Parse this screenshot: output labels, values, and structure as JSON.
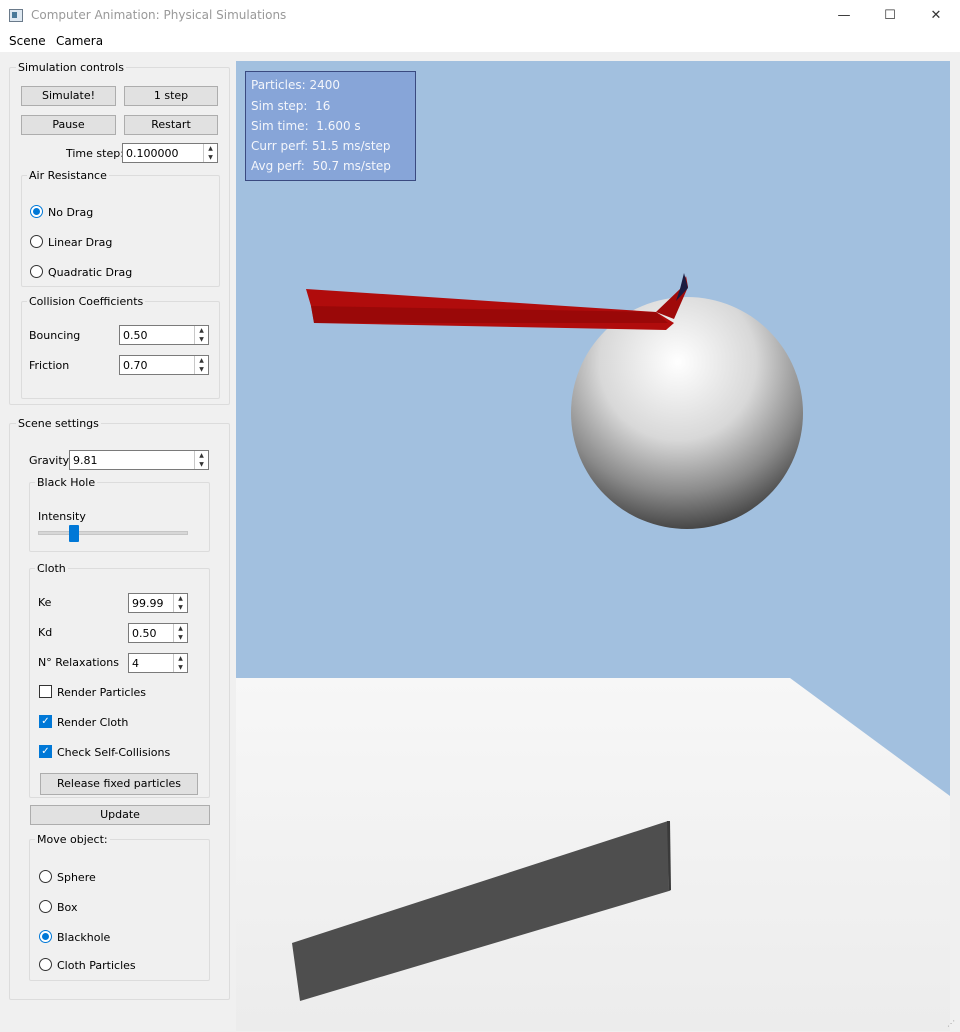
{
  "window": {
    "title": "Computer Animation: Physical Simulations",
    "minimize": "—",
    "maximize": "☐",
    "close": "✕"
  },
  "menu": {
    "scene": "Scene",
    "camera": "Camera"
  },
  "simulation_controls": {
    "title": "Simulation controls",
    "simulate_label": "Simulate!",
    "step_label": "1 step",
    "pause_label": "Pause",
    "restart_label": "Restart",
    "time_step_label": "Time step:",
    "time_step_value": "0.100000",
    "air_resistance": {
      "title": "Air Resistance",
      "options": [
        "No Drag",
        "Linear Drag",
        "Quadratic Drag"
      ],
      "selected": "No Drag"
    },
    "collision": {
      "title": "Collision Coefficients",
      "bouncing_label": "Bouncing",
      "bouncing_value": "0.50",
      "friction_label": "Friction",
      "friction_value": "0.70"
    }
  },
  "scene_settings": {
    "title": "Scene settings",
    "gravity_label": "Gravity",
    "gravity_value": "9.81",
    "black_hole": {
      "title": "Black Hole",
      "intensity_label": "Intensity",
      "intensity_level": 0.22
    },
    "cloth": {
      "title": "Cloth",
      "ke_label": "Ke",
      "ke_value": "99.99",
      "kd_label": "Kd",
      "kd_value": "0.50",
      "relax_label": "N° Relaxations",
      "relax_value": "4",
      "render_particles_label": "Render Particles",
      "render_particles": false,
      "render_cloth_label": "Render Cloth",
      "render_cloth": true,
      "self_collisions_label": "Check Self-Collisions",
      "self_collisions": true,
      "release_label": "Release fixed particles"
    },
    "update_label": "Update",
    "move_object": {
      "title": "Move object:",
      "options": [
        "Sphere",
        "Box",
        "Blackhole",
        "Cloth Particles"
      ],
      "selected": "Blackhole"
    }
  },
  "stats": {
    "particles": "Particles: 2400",
    "sim_step": "Sim step:  16",
    "sim_time": "Sim time:  1.600 s",
    "curr_perf": "Curr perf: 51.5 ms/step",
    "avg_perf": "Avg perf:  50.7 ms/step"
  },
  "colors": {
    "accent": "#0078d7",
    "sky": "#a2c0df",
    "cloth": "#b00c0c",
    "floor": "#f2f2f2",
    "box": "#4e4e4e"
  }
}
